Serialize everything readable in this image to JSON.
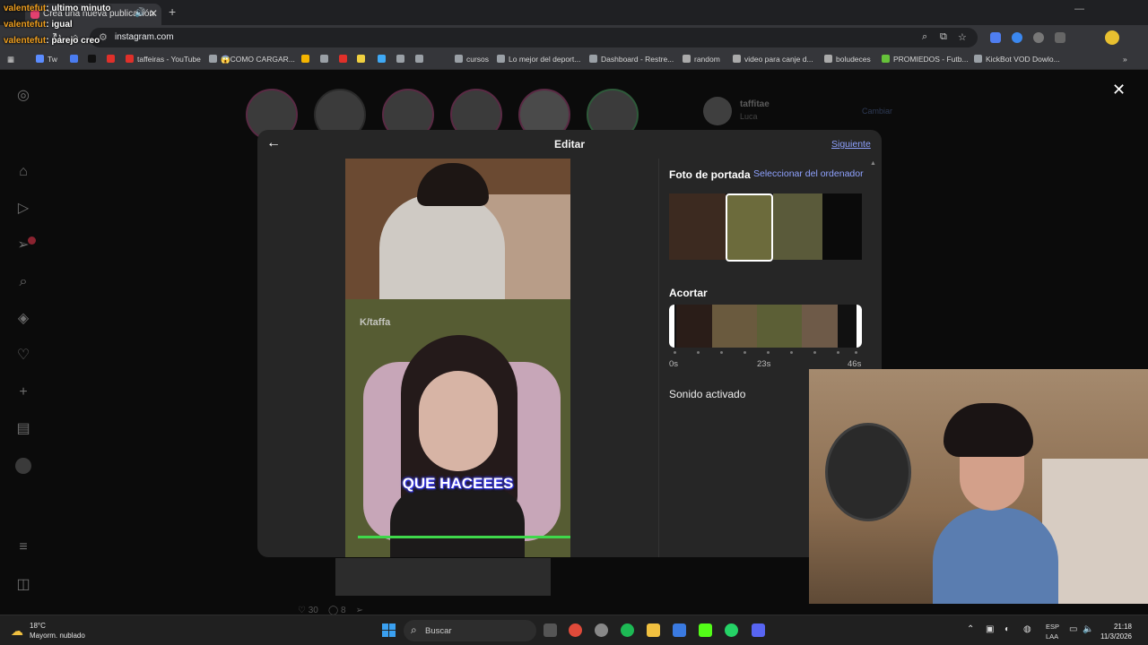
{
  "browser": {
    "tab_title": "Crea una nueva publicación",
    "url": "instagram.com",
    "bookmarks": [
      {
        "label": "Tw",
        "color": "#5b8cff"
      },
      {
        "label": "",
        "color": "#4a7cf0"
      },
      {
        "label": "",
        "color": "#111111"
      },
      {
        "label": "",
        "color": "#e0302a"
      },
      {
        "label": "taffeiras - YouTube",
        "color": "#e0302a"
      },
      {
        "label": "😱COMO CARGAR...",
        "color": "#9aa0a6"
      },
      {
        "label": "",
        "color": "#f4b400"
      },
      {
        "label": "",
        "color": "#9aa0a6"
      },
      {
        "label": "",
        "color": "#e0302a"
      },
      {
        "label": "",
        "color": "#f0d040"
      },
      {
        "label": "",
        "color": "#3fa9f5"
      },
      {
        "label": "",
        "color": "#9aa0a6"
      },
      {
        "label": "",
        "color": "#9aa0a6"
      },
      {
        "label": "cursos",
        "color": "#9aa0a6"
      },
      {
        "label": "Lo mejor del deport...",
        "color": "#9aa0a6"
      },
      {
        "label": "Dashboard - Restre...",
        "color": "#9aa0a6"
      },
      {
        "label": "random",
        "color": "#aaaaaa"
      },
      {
        "label": "video para canje d...",
        "color": "#aaaaaa"
      },
      {
        "label": "boludeces",
        "color": "#aaaaaa"
      },
      {
        "label": "PROMIEDOS - Futb...",
        "color": "#66c23a"
      },
      {
        "label": "KickBot VOD Dowlo...",
        "color": "#9aa0a6"
      }
    ]
  },
  "chat": [
    {
      "user": "valentefut",
      "message": ": ultimo minuto"
    },
    {
      "user": "valentefut",
      "message": ": igual"
    },
    {
      "user": "valentefut",
      "message": ": parejo creo"
    }
  ],
  "feed": {
    "username": "taffitae",
    "subtitle": "Luca",
    "switch_label": "Cambiar",
    "likes": "30",
    "comments": "8"
  },
  "modal": {
    "title": "Editar",
    "next_label": "Siguiente",
    "cover_label": "Foto de portada",
    "select_label": "Seleccionar del ordenador",
    "trim_label": "Acortar",
    "time_start": "0s",
    "time_mid": "23s",
    "time_end": "46s",
    "sound_label": "Sonido activado",
    "preview_caption": "QUE HACEEES",
    "preview_watermark": "K/taffa"
  },
  "taskbar": {
    "temperature": "18°C",
    "weather": "Mayorm. nublado",
    "search_label": "Buscar",
    "lang_line1": "ESP",
    "lang_line2": "LAA",
    "time": "21:18",
    "date": "11/3/2026"
  },
  "colors": {
    "accent_link": "#8fa2ff",
    "modal_bg": "#262626",
    "progress": "#3fd84b"
  }
}
